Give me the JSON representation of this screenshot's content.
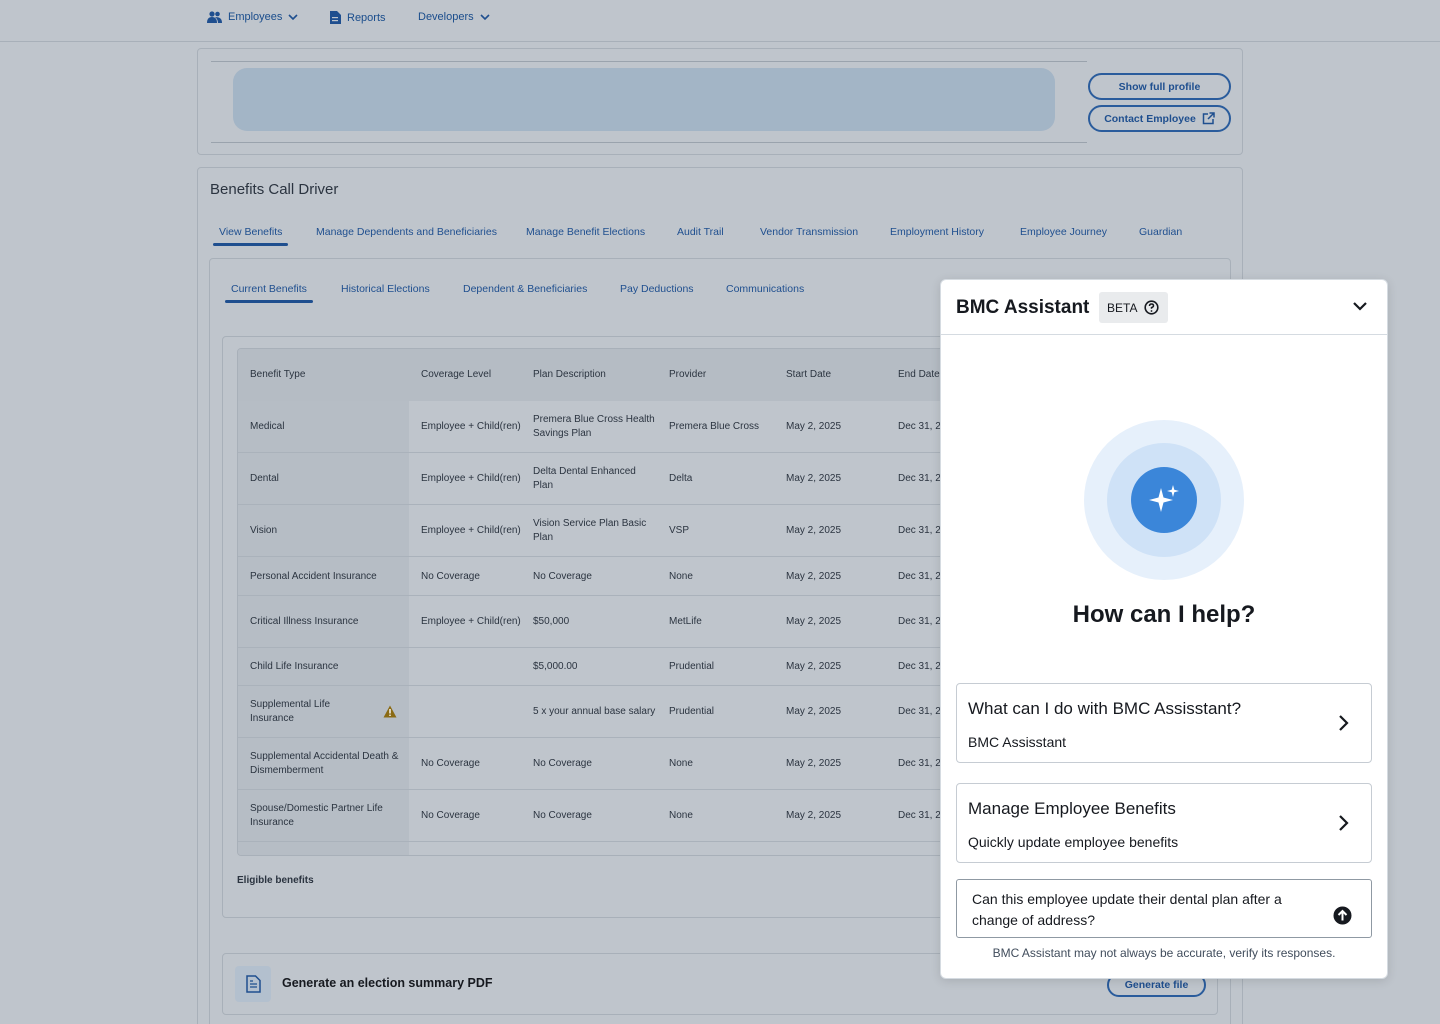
{
  "nav": {
    "items": [
      {
        "label": "Employees",
        "has_dropdown": true,
        "icon": "people-icon"
      },
      {
        "label": "Reports",
        "has_dropdown": false,
        "icon": "document-icon"
      },
      {
        "label": "Developers",
        "has_dropdown": true,
        "icon": ""
      }
    ]
  },
  "profile": {
    "show_full_profile_label": "Show full profile",
    "contact_employee_label": "Contact Employee"
  },
  "benefits": {
    "title": "Benefits Call Driver",
    "main_tabs": [
      {
        "label": "View Benefits",
        "active": true
      },
      {
        "label": "Manage Dependents and Beneficiaries",
        "active": false
      },
      {
        "label": "Manage Benefit Elections",
        "active": false
      },
      {
        "label": "Audit Trail",
        "active": false
      },
      {
        "label": "Vendor Transmission",
        "active": false
      },
      {
        "label": "Employment History",
        "active": false
      },
      {
        "label": "Employee Journey",
        "active": false
      },
      {
        "label": "Guardian",
        "active": false
      }
    ],
    "sub_tabs": [
      {
        "label": "Current Benefits",
        "active": true
      },
      {
        "label": "Historical Elections",
        "active": false
      },
      {
        "label": "Dependent & Beneficiaries",
        "active": false
      },
      {
        "label": "Pay Deductions",
        "active": false
      },
      {
        "label": "Communications",
        "active": false
      }
    ],
    "table": {
      "headers": [
        "Benefit Type",
        "Coverage Level",
        "Plan Description",
        "Provider",
        "Start Date",
        "End Date"
      ],
      "rows": [
        {
          "type": "Medical",
          "coverage": "Employee + Child(ren)",
          "plan": "Premera Blue Cross Health Savings Plan",
          "provider": "Premera Blue Cross",
          "start": "May 2, 2025",
          "end": "Dec 31, 2",
          "warning": false
        },
        {
          "type": "Dental",
          "coverage": "Employee + Child(ren)",
          "plan": "Delta Dental Enhanced Plan",
          "provider": "Delta",
          "start": "May 2, 2025",
          "end": "Dec 31, 2",
          "warning": false
        },
        {
          "type": "Vision",
          "coverage": "Employee + Child(ren)",
          "plan": "Vision Service Plan Basic Plan",
          "provider": "VSP",
          "start": "May 2, 2025",
          "end": "Dec 31, 2",
          "warning": false
        },
        {
          "type": "Personal Accident Insurance",
          "coverage": "No Coverage",
          "plan": "No Coverage",
          "provider": "None",
          "start": "May 2, 2025",
          "end": "Dec 31, 2",
          "warning": false
        },
        {
          "type": "Critical Illness Insurance",
          "coverage": "Employee + Child(ren)",
          "plan": "$50,000",
          "provider": "MetLife",
          "start": "May 2, 2025",
          "end": "Dec 31, 2",
          "warning": false
        },
        {
          "type": "Child Life Insurance",
          "coverage": "",
          "plan": "$5,000.00",
          "provider": "Prudential",
          "start": "May 2, 2025",
          "end": "Dec 31, 2",
          "warning": false
        },
        {
          "type": "Supplemental Life Insurance",
          "coverage": "",
          "plan": "5 x your annual base salary",
          "provider": "Prudential",
          "start": "May 2, 2025",
          "end": "Dec 31, 2",
          "warning": true
        },
        {
          "type": "Supplemental Accidental Death & Dismemberment",
          "coverage": "No Coverage",
          "plan": "No Coverage",
          "provider": "None",
          "start": "May 2, 2025",
          "end": "Dec 31, 2",
          "warning": false
        },
        {
          "type": "Spouse/Domestic Partner Life Insurance",
          "coverage": "No Coverage",
          "plan": "No Coverage",
          "provider": "None",
          "start": "May 2, 2025",
          "end": "Dec 31, 2",
          "warning": false
        }
      ]
    },
    "eligible_label": "Eligible benefits",
    "pdf_label": "Generate an election summary PDF",
    "generate_button": "Generate file"
  },
  "assistant": {
    "title": "BMC Assistant",
    "badge": "BETA",
    "heading": "How can I help?",
    "suggestions": [
      {
        "title": "What can I do with BMC Assisstant?",
        "subtitle": "BMC Assisstant"
      },
      {
        "title": "Manage Employee Benefits",
        "subtitle": "Quickly update employee benefits"
      }
    ],
    "prompt_value": "Can this employee update their dental plan after a change of address?",
    "disclaimer": "BMC Assistant may not always be accurate, verify its responses.",
    "accent_color": "#3b86d9"
  }
}
